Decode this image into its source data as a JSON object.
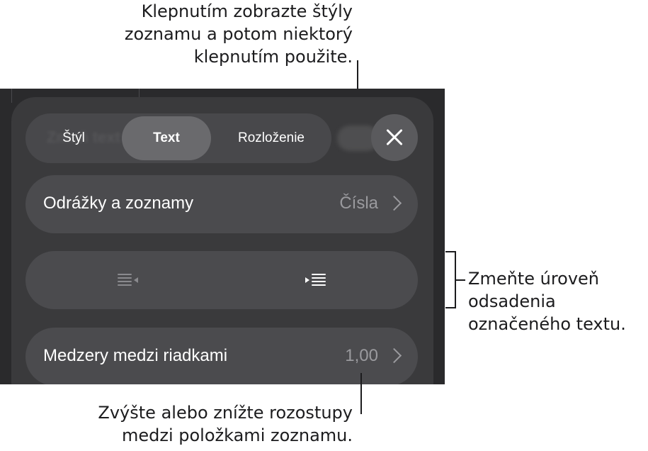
{
  "callouts": {
    "top": "Klepnutím zobrazte štýly\nzoznamu a potom niektorý\nklepnutím použite.",
    "right": "Zmeňte úroveň\nodsadenia\noznačeného textu.",
    "bottom": "Zvýšte alebo znížte rozostupy\nmedzi položkami zoznamu."
  },
  "tabs": {
    "ghost_title": "Zmeň text",
    "style_label": "Štýl",
    "text_label": "Text",
    "layout_label": "Rozloženie",
    "selected": "Text"
  },
  "bullets_row": {
    "label": "Odrážky a zoznamy",
    "value": "Čísla"
  },
  "spacing_row": {
    "label": "Medzery medzi riadkami",
    "value": "1,00"
  },
  "icons": {
    "close": "close-icon",
    "decrease_indent": "decrease-indent-icon",
    "increase_indent": "increase-indent-icon",
    "chevron": "chevron-right-icon"
  },
  "colors": {
    "panel": "#3a3a3c",
    "row": "#4b4b4e",
    "selected_tab": "#6a6a6d",
    "secondary_text": "#9a9a9e"
  }
}
